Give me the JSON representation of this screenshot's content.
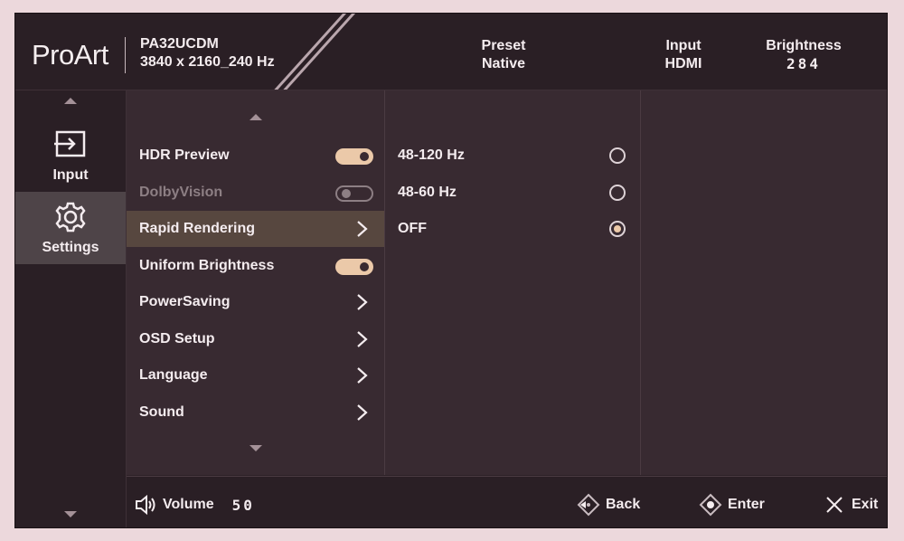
{
  "header": {
    "logo": "ProArt",
    "model": "PA32UCDM",
    "resolution": "3840 x 2160_240 Hz",
    "preset_label": "Preset",
    "preset_value": "Native",
    "input_label": "Input",
    "input_value": "HDMI",
    "brightness_label": "Brightness",
    "brightness_value": "284"
  },
  "sidebar": {
    "items": [
      {
        "label": "Input",
        "icon": "input-icon",
        "active": false
      },
      {
        "label": "Settings",
        "icon": "gear-icon",
        "active": true
      }
    ]
  },
  "menu": {
    "items": [
      {
        "label": "HDR Preview",
        "control": "toggle",
        "state": "on"
      },
      {
        "label": "DolbyVision",
        "control": "toggle",
        "state": "off",
        "disabled": true
      },
      {
        "label": "Rapid Rendering",
        "control": "chevron",
        "selected": true
      },
      {
        "label": "Uniform Brightness",
        "control": "toggle",
        "state": "on"
      },
      {
        "label": "PowerSaving",
        "control": "chevron"
      },
      {
        "label": "OSD Setup",
        "control": "chevron"
      },
      {
        "label": "Language",
        "control": "chevron"
      },
      {
        "label": "Sound",
        "control": "chevron"
      }
    ]
  },
  "submenu": {
    "options": [
      {
        "label": "48-120 Hz",
        "selected": false
      },
      {
        "label": "48-60 Hz",
        "selected": false
      },
      {
        "label": "OFF",
        "selected": true
      }
    ]
  },
  "footer": {
    "volume_label": "Volume",
    "volume_value": "50",
    "back_label": "Back",
    "enter_label": "Enter",
    "exit_label": "Exit"
  },
  "colors": {
    "accent": "#ebc9a9",
    "background": "#382a31",
    "header": "#2a1f25",
    "selected_row": "#57473f"
  }
}
